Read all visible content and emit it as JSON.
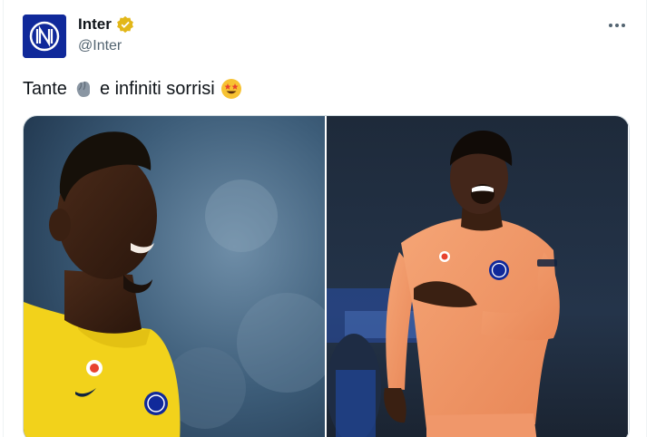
{
  "author": {
    "display_name": "Inter",
    "handle": "@Inter",
    "verified_icon": "verified-badge-icon",
    "avatar_icon": "inter-logo-icon"
  },
  "tweet": {
    "text_before": "Tante",
    "text_middle": "e infiniti sorrisi",
    "emoji_1": "gloves-emoji-icon",
    "emoji_2": "star-struck-emoji-icon"
  },
  "media": {
    "photos": [
      "goalkeeper-yellow-kit-photo",
      "goalkeeper-orange-kit-photo"
    ]
  },
  "colors": {
    "brand": "#10299a",
    "verified_gold": "#e2b719",
    "text_secondary": "#536471"
  }
}
